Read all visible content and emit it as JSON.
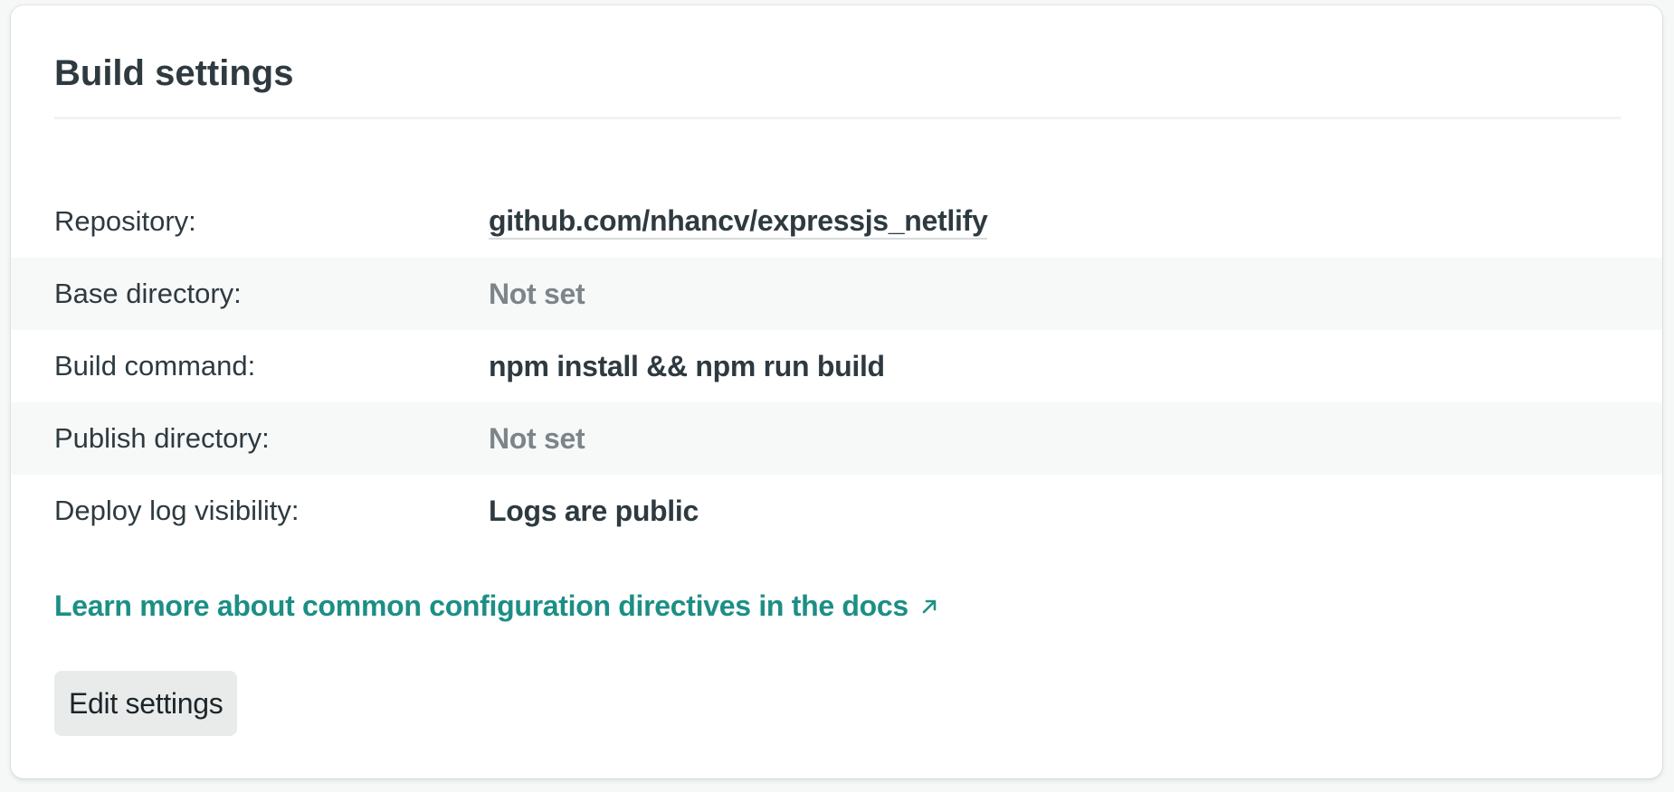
{
  "card": {
    "title": "Build settings"
  },
  "settings": [
    {
      "label": "Repository:",
      "value": "github.com/nhancv/expressjs_netlify",
      "style": "link"
    },
    {
      "label": "Base directory:",
      "value": "Not set",
      "style": "muted"
    },
    {
      "label": "Build command:",
      "value": "npm install && npm run build",
      "style": "strong"
    },
    {
      "label": "Publish directory:",
      "value": "Not set",
      "style": "muted"
    },
    {
      "label": "Deploy log visibility:",
      "value": "Logs are public",
      "style": "strong"
    }
  ],
  "docs_link": {
    "label": "Learn more about common configuration directives in the docs",
    "icon": "external-arrow-icon"
  },
  "actions": {
    "edit_label": "Edit settings"
  },
  "colors": {
    "accent": "#1c8f85",
    "text": "#2e3a40",
    "muted": "#7b858a",
    "row_shade": "#f7f8f8",
    "button_bg": "#e9ebeb"
  }
}
